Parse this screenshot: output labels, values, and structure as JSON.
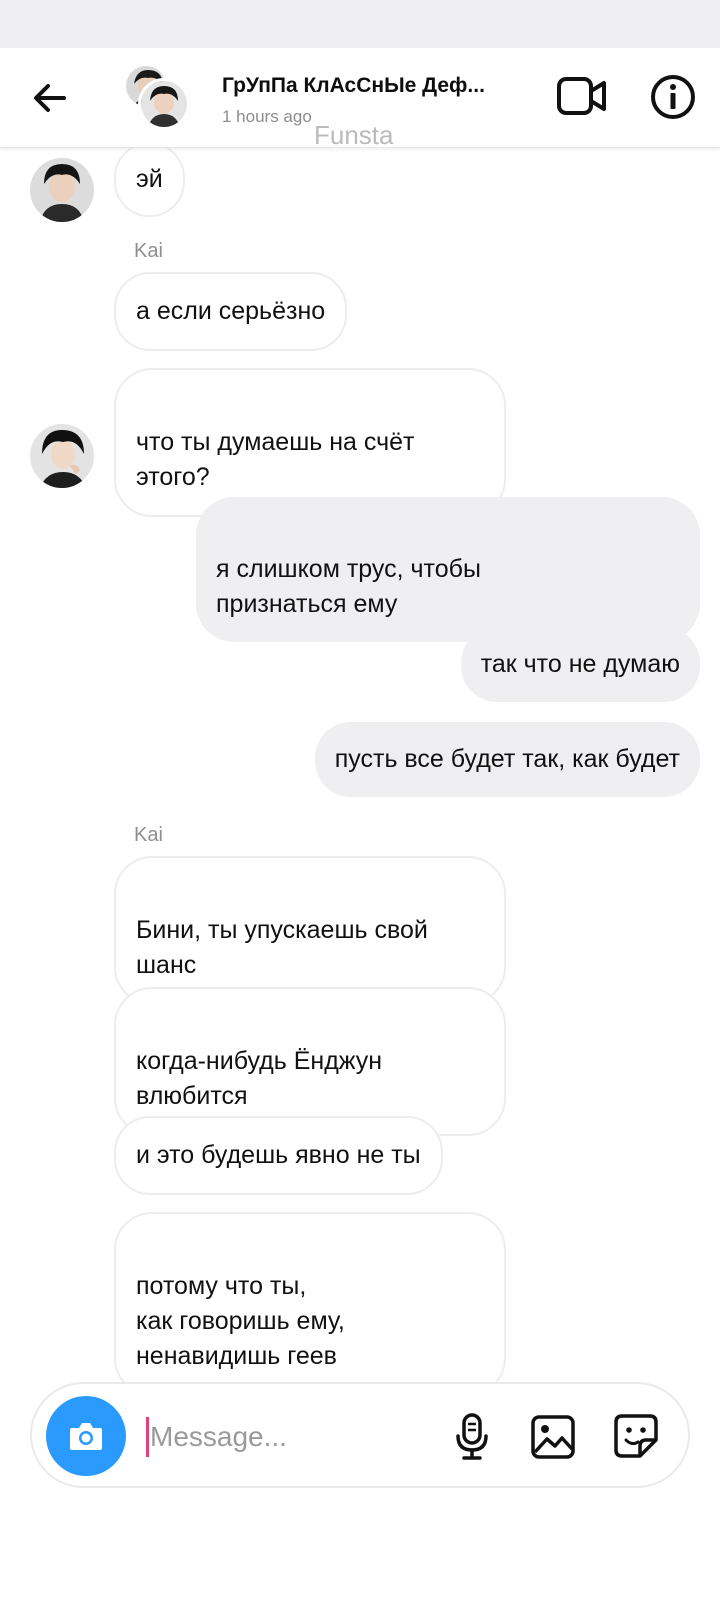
{
  "header": {
    "title": "ГрУпПа КлАсСнЫе Деф...",
    "subtitle": "1 hours ago",
    "watermark": "Funsta"
  },
  "messages": [
    {
      "text": "эй",
      "dir": "in"
    },
    {
      "text": "Kai",
      "type": "sender"
    },
    {
      "text": "а если серьёзно",
      "dir": "in"
    },
    {
      "text": "что ты думаешь на счёт\nэтого?",
      "dir": "in"
    },
    {
      "text": "я слишком трус, чтобы\nпризнаться ему",
      "dir": "out"
    },
    {
      "text": "так что не думаю",
      "dir": "out"
    },
    {
      "text": "пусть все будет так, как будет",
      "dir": "out"
    },
    {
      "text": "Kai",
      "type": "sender"
    },
    {
      "text": "Бини, ты упускаешь свой\nшанс",
      "dir": "in"
    },
    {
      "text": "когда-нибудь Ёнджун\nвлюбится",
      "dir": "in"
    },
    {
      "text": "и это будешь явно не ты",
      "dir": "in"
    },
    {
      "text": "потому что ты,\nкак говоришь ему,\nненавидишь геев",
      "dir": "in"
    }
  ],
  "composer": {
    "placeholder": "Message...",
    "value": ""
  },
  "icons": {
    "back": "arrow-left-icon",
    "video": "video-camera-icon",
    "info": "info-icon",
    "camera": "camera-icon",
    "mic": "microphone-icon",
    "gallery": "image-icon",
    "sticker": "sticker-icon"
  },
  "colors": {
    "camera_button": "#2b9aff",
    "outgoing_bubble": "#efeef1",
    "incoming_border": "#ededf0",
    "caret": "#e23f7b"
  }
}
